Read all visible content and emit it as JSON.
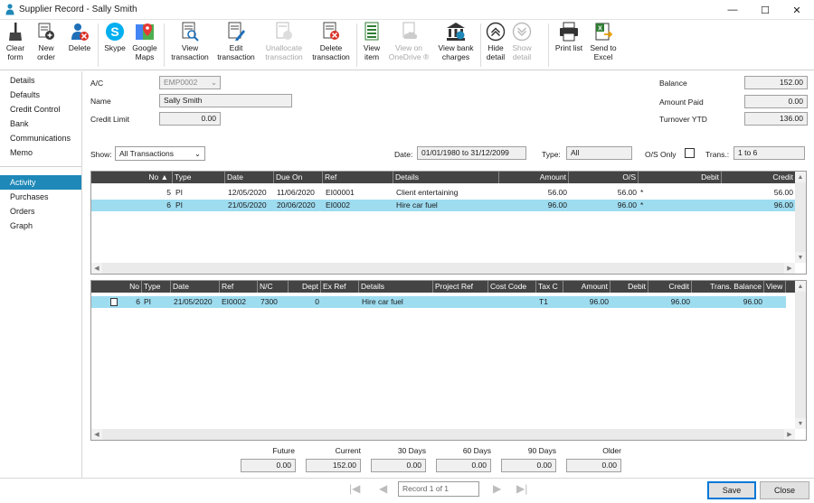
{
  "window": {
    "title": "Supplier Record - Sally Smith",
    "controls": {
      "minimize": "—",
      "maximize": "☐",
      "close": "✕"
    }
  },
  "toolbar": {
    "clear_form": "Clear\nform",
    "new_order": "New\norder",
    "delete": "Delete",
    "skype": "Skype",
    "google_maps": "Google\nMaps",
    "view_transaction": "View\ntransaction",
    "edit_transaction": "Edit\ntransaction",
    "unallocate_transaction": "Unallocate\ntransaction",
    "delete_transaction": "Delete\ntransaction",
    "view_item": "View\nitem",
    "view_on_onedrive": "View on\nOneDrive ®",
    "view_bank_charges": "View bank\ncharges",
    "hide_detail": "Hide\ndetail",
    "show_detail": "Show\ndetail",
    "print_list": "Print list",
    "send_to_excel": "Send to\nExcel"
  },
  "sidebar": {
    "group1": [
      "Details",
      "Defaults",
      "Credit Control",
      "Bank",
      "Communications",
      "Memo"
    ],
    "group2": [
      "Activity",
      "Purchases",
      "Orders",
      "Graph"
    ],
    "active": "Activity"
  },
  "account": {
    "ac_label": "A/C",
    "ac_value": "EMP0002",
    "name_label": "Name",
    "name_value": "Sally Smith",
    "credit_limit_label": "Credit Limit",
    "credit_limit_value": "0.00",
    "balance_label": "Balance",
    "balance_value": "152.00",
    "amount_paid_label": "Amount Paid",
    "amount_paid_value": "0.00",
    "turnover_label": "Turnover YTD",
    "turnover_value": "136.00"
  },
  "filters": {
    "show_label": "Show:",
    "show_value": "All Transactions",
    "date_label": "Date:",
    "date_value": "01/01/1980 to 31/12/2099",
    "type_label": "Type:",
    "type_value": "All",
    "os_only_label": "O/S Only",
    "trans_label": "Trans.:",
    "trans_value": "1 to 6"
  },
  "upper_grid": {
    "headers": [
      "No",
      "Type",
      "Date",
      "Due On",
      "Ref",
      "Details",
      "Amount",
      "O/S",
      "Debit",
      "Credit"
    ],
    "rows": [
      {
        "no": "5",
        "type": "PI",
        "date": "12/05/2020",
        "due": "11/06/2020",
        "ref": "EI00001",
        "details": "Client entertaining",
        "amount": "56.00",
        "os": "56.00",
        "flag": "*",
        "debit": "",
        "credit": "56.00"
      },
      {
        "no": "6",
        "type": "PI",
        "date": "21/05/2020",
        "due": "20/06/2020",
        "ref": "EI0002",
        "details": "Hire car fuel",
        "amount": "96.00",
        "os": "96.00",
        "flag": "*",
        "debit": "",
        "credit": "96.00"
      }
    ]
  },
  "lower_grid": {
    "headers": [
      "No",
      "Type",
      "Date",
      "Ref",
      "N/C",
      "Dept",
      "Ex Ref",
      "Details",
      "Project Ref",
      "Cost Code",
      "Tax C",
      "Amount",
      "Debit",
      "Credit",
      "Trans. Balance",
      "View"
    ],
    "rows": [
      {
        "no": "6",
        "type": "PI",
        "date": "21/05/2020",
        "ref": "EI0002",
        "nc": "7300",
        "dept": "0",
        "exref": "",
        "details": "Hire car fuel",
        "project": "",
        "cost": "",
        "tax": "T1",
        "amount": "96.00",
        "debit": "",
        "credit": "96.00",
        "balance": "96.00"
      }
    ]
  },
  "aging": {
    "labels": [
      "Future",
      "Current",
      "30 Days",
      "60 Days",
      "90 Days",
      "Older"
    ],
    "values": [
      "0.00",
      "152.00",
      "0.00",
      "0.00",
      "0.00",
      "0.00"
    ]
  },
  "footer": {
    "record": "Record 1 of 1",
    "save": "Save",
    "close": "Close"
  }
}
